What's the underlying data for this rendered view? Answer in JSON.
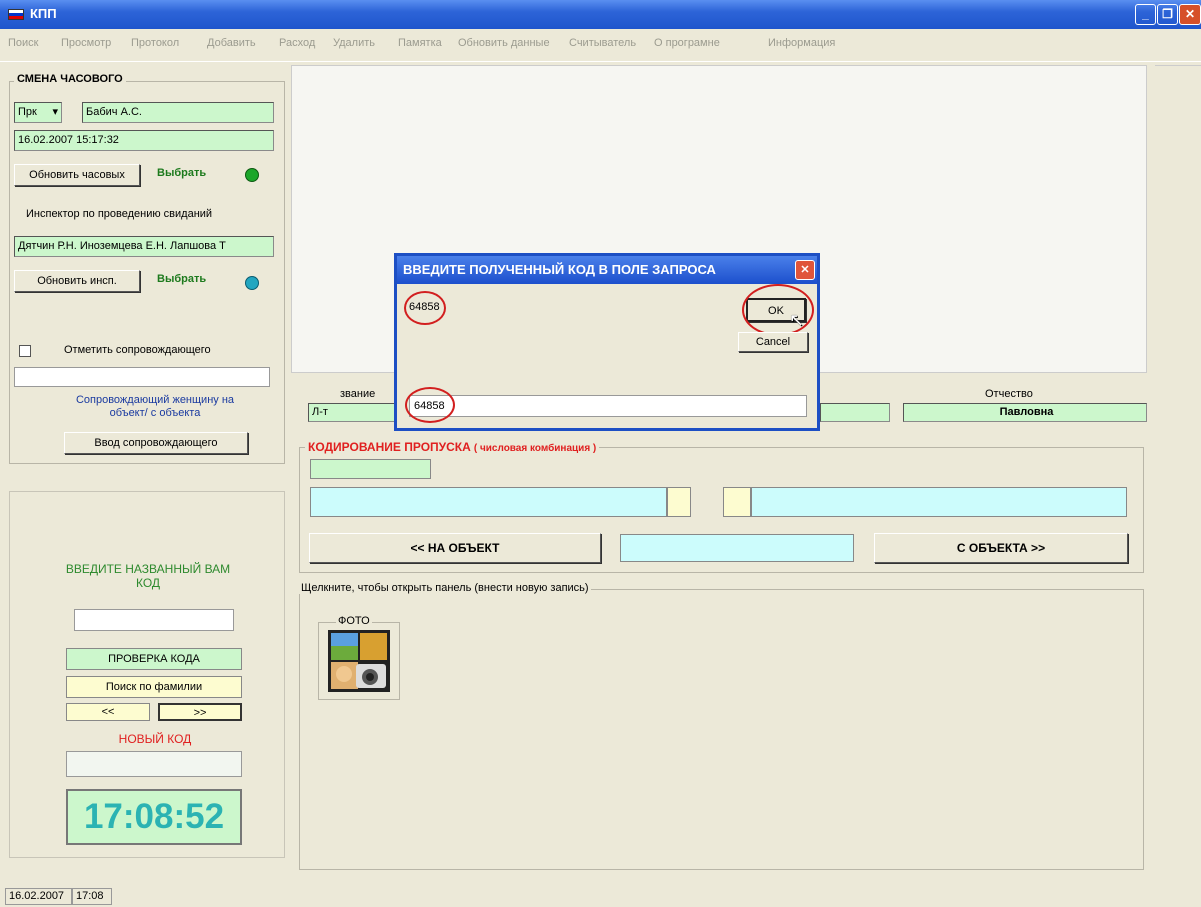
{
  "window": {
    "title": "КПП",
    "flag_colors": [
      "#ffffff",
      "#0033cc",
      "#dd0000"
    ]
  },
  "menu": {
    "items": [
      "Поиск",
      "Просмотр",
      "Протокол",
      "Добавить",
      "Расход",
      "Удалить",
      "Памятка",
      "Обновить данные",
      "Считыватель",
      "О програмне",
      "Информация"
    ]
  },
  "shift": {
    "group_title": "СМЕНА ЧАСОВОГО",
    "rank": "Прк",
    "name": "Бабич А.С.",
    "datetime": "16.02.2007 15:17:32",
    "refresh_guards_label": "Обновить часовых",
    "select_label": "Выбрать",
    "inspector_caption": "Инспектор по проведению свиданий",
    "inspectors": "Дятчин Р.Н. Иноземцева Е.Н. Лапшова Т",
    "refresh_insp_label": "Обновить инсп.",
    "select_label_2": "Выбрать",
    "mark_escort_label": "Отметить сопровождающего",
    "escort_value": "",
    "escort_caption": "Сопровождающий женщину на объект/ с объекта",
    "escort_input_label": "Ввод сопровождающего"
  },
  "code_panel": {
    "prompt": "ВВЕДИТЕ НАЗВАННЫЙ ВАМ КОД",
    "code_value": "",
    "check_label": "ПРОВЕРКА КОДА",
    "search_label": "Поиск по фамилии",
    "prev_label": "<<",
    "next_label": ">>",
    "new_code_label": "НОВЫЙ КОД",
    "new_code_value": "",
    "clock": "17:08:52"
  },
  "person": {
    "rank_caption": "звание",
    "rank_value": "Л-т",
    "patronymic_caption": "Отчество",
    "patronymic_value": "Павловна"
  },
  "pass_coding": {
    "title": "КОДИРОВАНИЕ ПРОПУСКА",
    "subtitle": "( числовая комбинация )",
    "to_object_label": "<< НА ОБЪЕКТ",
    "from_object_label": "С ОБЪЕКТА >>"
  },
  "panel": {
    "caption": "Щелкните, чтобы открыть панель (внести новую запись)",
    "photo_label": "ФОТО"
  },
  "dialog": {
    "title": "ВВЕДИТЕ ПОЛУЧЕННЫЙ КОД  В ПОЛЕ ЗАПРОСА",
    "code": "64858",
    "ok_label": "OK",
    "cancel_label": "Cancel",
    "input_value": "64858"
  },
  "status_bar": {
    "date": "16.02.2007",
    "time": "17:08"
  }
}
